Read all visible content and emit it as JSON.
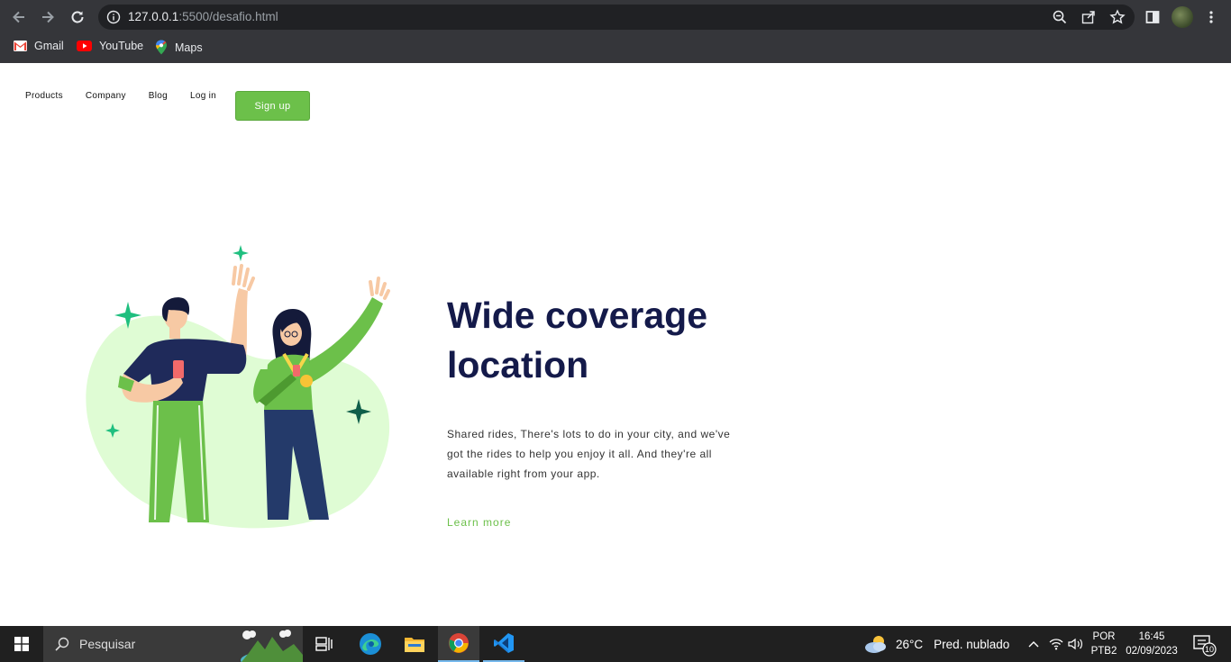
{
  "browser": {
    "url_host": "127.0.0.1",
    "url_path": ":5500/desafio.html",
    "bookmarks": [
      {
        "label": "Gmail",
        "icon": "gmail-icon"
      },
      {
        "label": "YouTube",
        "icon": "youtube-icon"
      },
      {
        "label": "Maps",
        "icon": "maps-icon"
      }
    ]
  },
  "nav": {
    "items": [
      "Products",
      "Company",
      "Blog",
      "Log in"
    ],
    "signup_label": "Sign up"
  },
  "hero": {
    "title_line1": "Wide coverage",
    "title_line2": "location",
    "description": "Shared rides, There's lots to do in your city, and we've got the rides to help you enjoy it all. And they're all available right from your app.",
    "link_label": "Learn more"
  },
  "colors": {
    "accent": "#6cc04a",
    "headline": "#141a4a",
    "blob": "#dffcd4"
  },
  "taskbar": {
    "search_placeholder": "Pesquisar",
    "weather_temp": "26°C",
    "weather_text": "Pred. nublado",
    "lang_line1": "POR",
    "lang_line2": "PTB2",
    "time": "16:45",
    "date": "02/09/2023",
    "notifications": "10"
  }
}
